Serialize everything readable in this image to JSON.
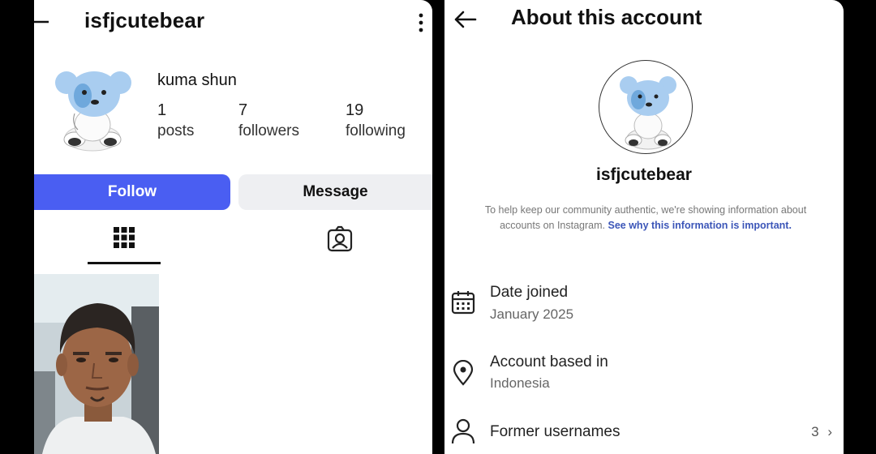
{
  "profile": {
    "username": "isfjcutebear",
    "display_name": "kuma shun",
    "stats": [
      {
        "value": "1",
        "label": "posts"
      },
      {
        "value": "7",
        "label": "followers"
      },
      {
        "value": "19",
        "label": "following"
      }
    ],
    "follow_label": "Follow",
    "message_label": "Message",
    "tabs": [
      "grid-icon",
      "tagged-icon"
    ]
  },
  "about": {
    "title": "About this account",
    "username": "isfjcutebear",
    "info_text": "To help keep our community authentic, we're showing information about accounts on Instagram.",
    "info_link": "See why this information is important.",
    "date_joined_label": "Date joined",
    "date_joined_value": "January 2025",
    "based_in_label": "Account based in",
    "based_in_value": "Indonesia",
    "former_label": "Former usernames",
    "former_count": "3"
  },
  "colors": {
    "follow_button": "#4a5ef2",
    "message_button": "#eeeff2",
    "link": "#3c56b8",
    "bear": "#a9cdf0"
  }
}
